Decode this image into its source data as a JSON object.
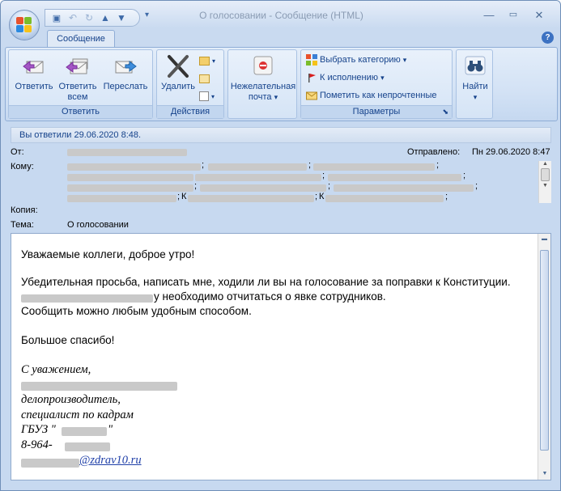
{
  "window": {
    "title": "О голосовании - Сообщение (HTML)",
    "controls": {
      "minimize": "—",
      "maximize": "▭",
      "close": "✕"
    }
  },
  "quick_access": {
    "save_icon": "save-icon",
    "undo_icon": "undo-icon",
    "redo_icon": "redo-icon",
    "prev_icon": "up-arrow-icon",
    "next_icon": "down-arrow-icon"
  },
  "ribbon": {
    "tab_label": "Сообщение",
    "help": "?",
    "groups": {
      "respond": {
        "label": "Ответить",
        "reply": "Ответить",
        "reply_all_line1": "Ответить",
        "reply_all_line2": "всем",
        "forward": "Переслать"
      },
      "actions": {
        "label": "Действия",
        "delete": "Удалить"
      },
      "junk": {
        "line1": "Нежелательная",
        "line2": "почта",
        "arrow": "▾"
      },
      "options": {
        "label": "Параметры",
        "categorize": "Выбрать категорию",
        "followup": "К исполнению",
        "mark_unread": "Пометить как непрочтенные",
        "arrow": "▾",
        "launcher": "⬊"
      },
      "find": {
        "label": "Найти",
        "arrow": "▾"
      }
    }
  },
  "message": {
    "info_bar": "Вы ответили 29.06.2020 8:48.",
    "from_label": "От:",
    "sent_label": "Отправлено:",
    "sent_value": "Пн 29.06.2020 8:47",
    "to_label": "Кому:",
    "cc_label": "Копия:",
    "subject_label": "Тема:",
    "subject_value": "О голосовании",
    "sep_semicolon": ";",
    "sep_k": "К",
    "body": {
      "greeting": "Уважаемые коллеги, доброе утро!",
      "line1": "Убедительная просьба, написать мне, ходили ли вы на голосование за поправки к Конституции.",
      "line2": "у необходимо отчитаться о явке сотрудников.",
      "line3": "Сообщить можно любым удобным способом.",
      "thanks": "Большое спасибо!"
    },
    "signature": {
      "regards": "С уважением,",
      "position1": "делопроизводитель,",
      "position2": "специалист по кадрам",
      "org_prefix": "ГБУЗ \"",
      "org_suffix": "\"",
      "phone_prefix": "8-964-",
      "email_suffix": "@zdrav10.ru"
    }
  }
}
